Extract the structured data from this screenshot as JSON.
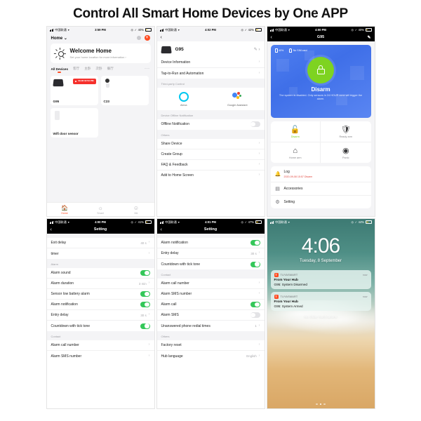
{
  "page": {
    "title": "Control All Smart Home Devices by One APP"
  },
  "colors": {
    "accent": "#ff4d23",
    "green": "#34c759",
    "alarm_green": "#7ed321",
    "blue": "#4f7ff0",
    "red": "#f5302c"
  },
  "phone1": {
    "status": {
      "carrier": "中国联通",
      "time": "3:59 PM",
      "battery": "40%"
    },
    "home_label": "Home",
    "icons": {
      "mic": "mic-icon",
      "add": "plus-icon"
    },
    "welcome": {
      "title": "Welcome Home",
      "subtitle": "Set your home location for more information  ›",
      "icon": "sun-icon"
    },
    "tabs": [
      {
        "label": "All Devices",
        "active": true
      },
      {
        "label": "客厅",
        "active": false
      },
      {
        "label": "主卧",
        "active": false
      },
      {
        "label": "次卧",
        "active": false
      },
      {
        "label": "餐厅",
        "active": false
      }
    ],
    "tabs_more": "···",
    "devices": [
      {
        "name": "G95",
        "icon": "hub-icon",
        "badge": "09-08 02:53 PM"
      },
      {
        "name": "C23",
        "icon": "camera-icon",
        "badge": ""
      },
      {
        "name": "Wifi door sensor",
        "icon": "door-sensor-icon",
        "badge": ""
      }
    ],
    "tabbar": [
      {
        "label": "Home",
        "icon": "home-icon",
        "active": true
      },
      {
        "label": "Smart",
        "icon": "smart-icon",
        "active": false
      },
      {
        "label": "Me",
        "icon": "profile-icon",
        "active": false
      }
    ]
  },
  "phone2": {
    "status": {
      "carrier": "中国联通",
      "time": "4:02 PM",
      "battery": "42%"
    },
    "device": {
      "name": "G95",
      "icon": "hub-icon",
      "edit_icon": "pencil-icon"
    },
    "rows_top": [
      {
        "label": "Device Information"
      },
      {
        "label": "Tap-to-Run and Automation"
      }
    ],
    "group_third_party": "Third-party Control",
    "third_party": [
      {
        "label": "Alexa",
        "icon": "alexa-icon"
      },
      {
        "label": "Google Assistant",
        "icon": "google-assistant-icon"
      }
    ],
    "group_offline": "Device Offline Notification",
    "offline": {
      "label": "Offline Notification",
      "on": false
    },
    "group_others": "Others",
    "rows_others": [
      {
        "label": "Share Device"
      },
      {
        "label": "Create Group"
      },
      {
        "label": "FAQ & Feedback"
      },
      {
        "label": "Add to Home Screen"
      }
    ]
  },
  "phone3": {
    "status": {
      "carrier": "中国联通",
      "time": "4:00 PM",
      "battery": "40%"
    },
    "nav": {
      "title": "G95",
      "back": "‹",
      "edit": "✎"
    },
    "hero": {
      "battery": "40%",
      "sim": "No SIM card",
      "state": "Disarm",
      "desc": "The system is disabled. Only sensors in 24 HOUR zone will trigger the alarm.",
      "icon": "unlocked-padlock-icon"
    },
    "modes": [
      {
        "label": "Disarm",
        "icon": "unlock-icon",
        "active": true
      },
      {
        "label": "Ready arm",
        "icon": "shield-check-icon",
        "active": false
      },
      {
        "label": "Home arm",
        "icon": "house-icon",
        "active": false
      },
      {
        "label": "Panic",
        "icon": "siren-icon",
        "active": false
      }
    ],
    "menu": [
      {
        "label": "Log",
        "sub": "2020-09-08 15:57 Disarm",
        "icon": "bell-icon"
      },
      {
        "label": "Accessories",
        "sub": "",
        "icon": "accessories-icon"
      },
      {
        "label": "Setting",
        "sub": "",
        "icon": "gear-icon"
      }
    ]
  },
  "phone4": {
    "status": {
      "carrier": "中国联通",
      "time": "4:00 PM",
      "battery": "41%"
    },
    "nav": {
      "title": "Setting",
      "back": "‹"
    },
    "rows_top": [
      {
        "label": "Exit delay",
        "value": "40 s",
        "type": "value"
      },
      {
        "label": "timer",
        "value": "",
        "type": "value"
      }
    ],
    "group_alarm": "Alarm",
    "rows_alarm": [
      {
        "label": "Alarm sound",
        "type": "toggle",
        "on": true
      },
      {
        "label": "Alarm duration",
        "type": "value",
        "value": "3 min"
      },
      {
        "label": "Sensor low battery alarm",
        "type": "toggle",
        "on": true
      },
      {
        "label": "Alarm notification",
        "type": "toggle",
        "on": true
      },
      {
        "label": "Entry delay",
        "type": "value",
        "value": "30 s"
      },
      {
        "label": "Countdown with tick tone",
        "type": "toggle",
        "on": true
      }
    ],
    "group_contact": "Contact",
    "rows_contact": [
      {
        "label": "Alarm call number",
        "type": "value",
        "value": ""
      },
      {
        "label": "Alarm SMS number",
        "type": "value",
        "value": ""
      }
    ]
  },
  "phone5": {
    "status": {
      "carrier": "中国联通",
      "time": "4:01 PM",
      "battery": "47%"
    },
    "nav": {
      "title": "Setting",
      "back": "‹"
    },
    "rows_top": [
      {
        "label": "Alarm notification",
        "type": "toggle",
        "on": true
      },
      {
        "label": "Entry delay",
        "type": "value",
        "value": "30 s"
      },
      {
        "label": "Countdown with tick tone",
        "type": "toggle",
        "on": true
      }
    ],
    "group_contact": "Contact",
    "rows_contact": [
      {
        "label": "Alarm call number",
        "type": "value",
        "value": ""
      },
      {
        "label": "Alarm SMS number",
        "type": "value",
        "value": ""
      },
      {
        "label": "Alarm call",
        "type": "toggle",
        "on": true
      },
      {
        "label": "Alarm SMS",
        "type": "toggle",
        "on": false
      },
      {
        "label": "Unanswered phone redial times",
        "type": "value",
        "value": "1"
      }
    ],
    "group_others": "Others",
    "rows_others": [
      {
        "label": "Factory reset",
        "type": "value",
        "value": ""
      },
      {
        "label": "Hub language",
        "type": "value",
        "value": "English"
      }
    ]
  },
  "phone6": {
    "status": {
      "carrier": "中国联通",
      "time": "",
      "battery": "44%"
    },
    "clock": {
      "time": "4:06",
      "date": "Tuesday, 8 September"
    },
    "notifications": [
      {
        "app": "TUYASMART",
        "app_initial": "T",
        "time": "now",
        "title": "From Your Hub",
        "body": "G95: System Disarmed"
      },
      {
        "app": "TUYASMART",
        "app_initial": "T",
        "time": "now",
        "title": "From Your Hub",
        "body": "G95: System Armed"
      }
    ],
    "older_text": "No Older Notifications",
    "page_dots": 3,
    "page_dot_active": 2
  }
}
